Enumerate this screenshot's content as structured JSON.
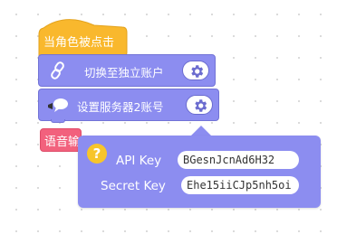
{
  "blocks": {
    "hat": {
      "label": "当角色被点击"
    },
    "switch_account": {
      "label": "切换至独立账户"
    },
    "set_server": {
      "label": "设置服务器2账号"
    },
    "say": {
      "label": "语音输"
    }
  },
  "popup": {
    "help_symbol": "?",
    "api_key_label": "API Key",
    "api_key_value": "BGesnJcnAd6H32",
    "secret_key_label": "Secret Key",
    "secret_key_value": "Ehe15iiCJp5nh5oi"
  },
  "colors": {
    "event_block": "#f9b82d",
    "extension_block": "#8c8df0",
    "speech_block": "#f2617d",
    "help_badge": "#f7c52b"
  },
  "icons": {
    "switch_account": "link-chain-icon",
    "set_server": "speech-bubble-icon",
    "settings": "gear-icon"
  }
}
